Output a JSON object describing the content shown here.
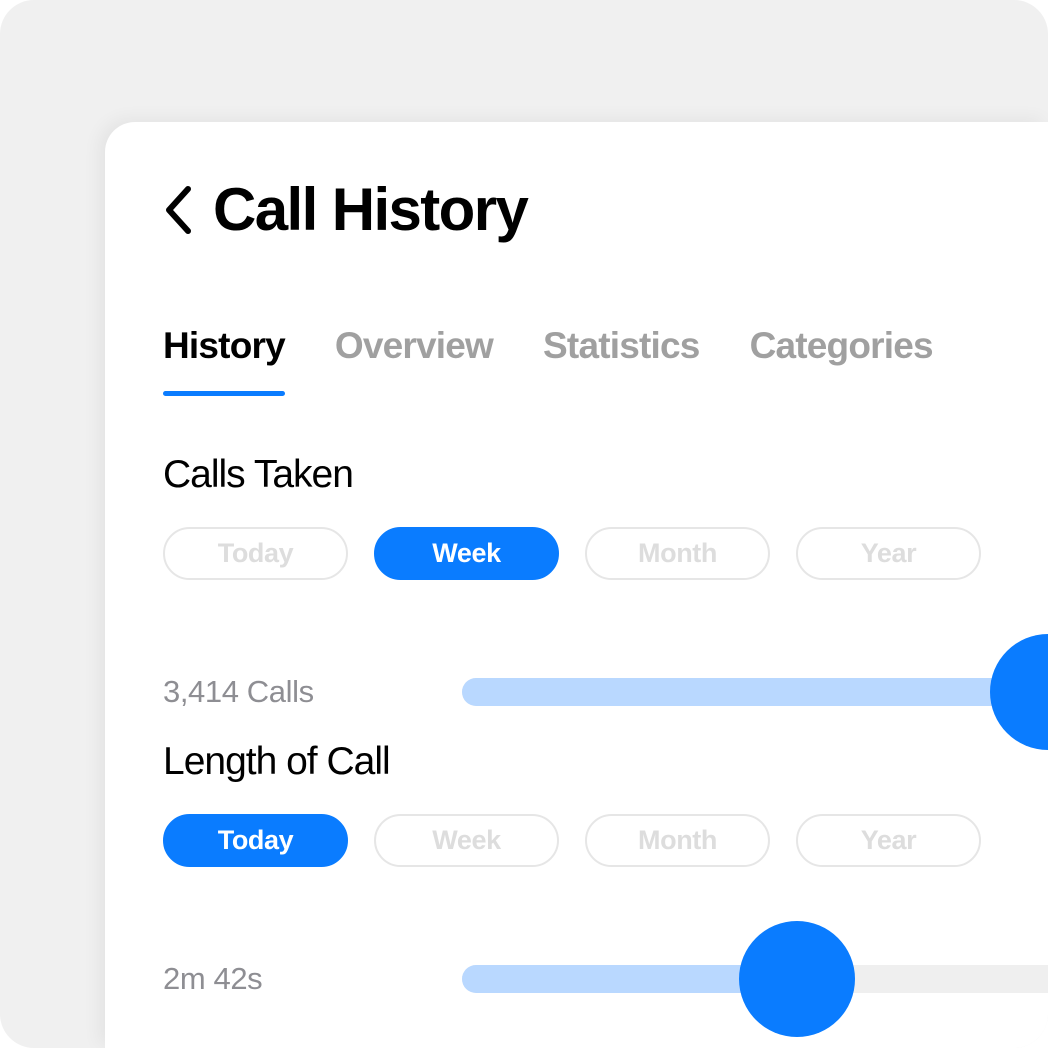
{
  "window": {
    "background_color": "#f0f0f0",
    "card_color": "#ffffff"
  },
  "header": {
    "back_icon": "chevron-left-icon",
    "title": "Call History"
  },
  "tabs": [
    {
      "label": "History",
      "active": true
    },
    {
      "label": "Overview",
      "active": false
    },
    {
      "label": "Statistics",
      "active": false
    },
    {
      "label": "Categories",
      "active": false
    }
  ],
  "theme": {
    "accent": "#0a7cff",
    "accent_light": "#b9d8ff",
    "track": "#efefef",
    "muted_text": "#8e8e93",
    "pill_border": "#e6e6e6",
    "pill_text": "#dddddd",
    "tab_inactive": "#a0a0a0"
  },
  "sections": [
    {
      "title": "Calls Taken",
      "ranges": [
        {
          "label": "Today",
          "selected": false
        },
        {
          "label": "Week",
          "selected": true
        },
        {
          "label": "Month",
          "selected": false
        },
        {
          "label": "Year",
          "selected": false
        }
      ],
      "slider": {
        "value_label": "3,414 Calls",
        "percent": 91
      }
    },
    {
      "title": "Length of Call",
      "ranges": [
        {
          "label": "Today",
          "selected": true
        },
        {
          "label": "Week",
          "selected": false
        },
        {
          "label": "Month",
          "selected": false
        },
        {
          "label": "Year",
          "selected": false
        }
      ],
      "slider": {
        "value_label": "2m 42s",
        "percent": 52
      }
    }
  ]
}
